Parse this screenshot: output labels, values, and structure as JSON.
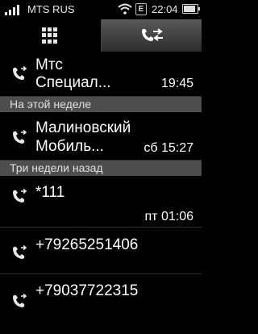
{
  "status": {
    "carrier": "MTS RUS",
    "network_badge": "E",
    "time": "22:04",
    "battery_level": 0.75,
    "signal_bars": 4
  },
  "tabs": [
    {
      "icon": "dialpad-icon",
      "selected": false
    },
    {
      "icon": "call-log-icon",
      "selected": true
    }
  ],
  "calls": {
    "row1": {
      "name_line1": "Мтс",
      "name_line2": "Специал...",
      "time": "19:45",
      "icon": "outgoing-call-icon"
    },
    "section1": "На этой неделе",
    "row2": {
      "name_line1": "Малиновский",
      "name_line2": "Мобиль...",
      "time": "сб 15:27",
      "icon": "outgoing-call-icon"
    },
    "section2": "Три недели назад",
    "row3": {
      "name": "*111",
      "time": "пт 01:06",
      "icon": "outgoing-call-icon"
    },
    "row4": {
      "name": "+79265251406",
      "icon": "outgoing-call-icon"
    },
    "row5": {
      "name": "+79037722315",
      "icon": "outgoing-call-icon"
    }
  }
}
